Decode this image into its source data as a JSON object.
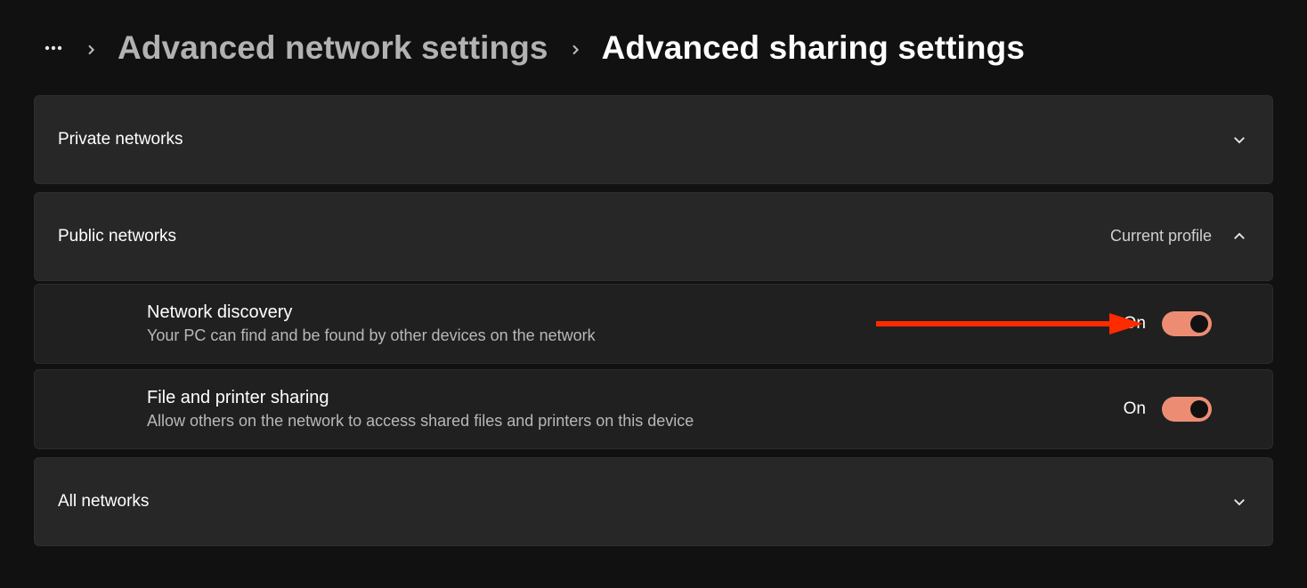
{
  "breadcrumb": {
    "parent": "Advanced network settings",
    "current": "Advanced sharing settings"
  },
  "sections": {
    "private": {
      "title": "Private networks",
      "expanded": false
    },
    "public": {
      "title": "Public networks",
      "badge": "Current profile",
      "expanded": true,
      "items": {
        "network_discovery": {
          "title": "Network discovery",
          "desc": "Your PC can find and be found by other devices on the network",
          "state_label": "On",
          "on": true
        },
        "file_printer_sharing": {
          "title": "File and printer sharing",
          "desc": "Allow others on the network to access shared files and printers on this device",
          "state_label": "On",
          "on": true
        }
      }
    },
    "all": {
      "title": "All networks",
      "expanded": false
    }
  },
  "colors": {
    "toggle_on_bg": "#ec8d73",
    "annotation": "#ff2a00"
  }
}
